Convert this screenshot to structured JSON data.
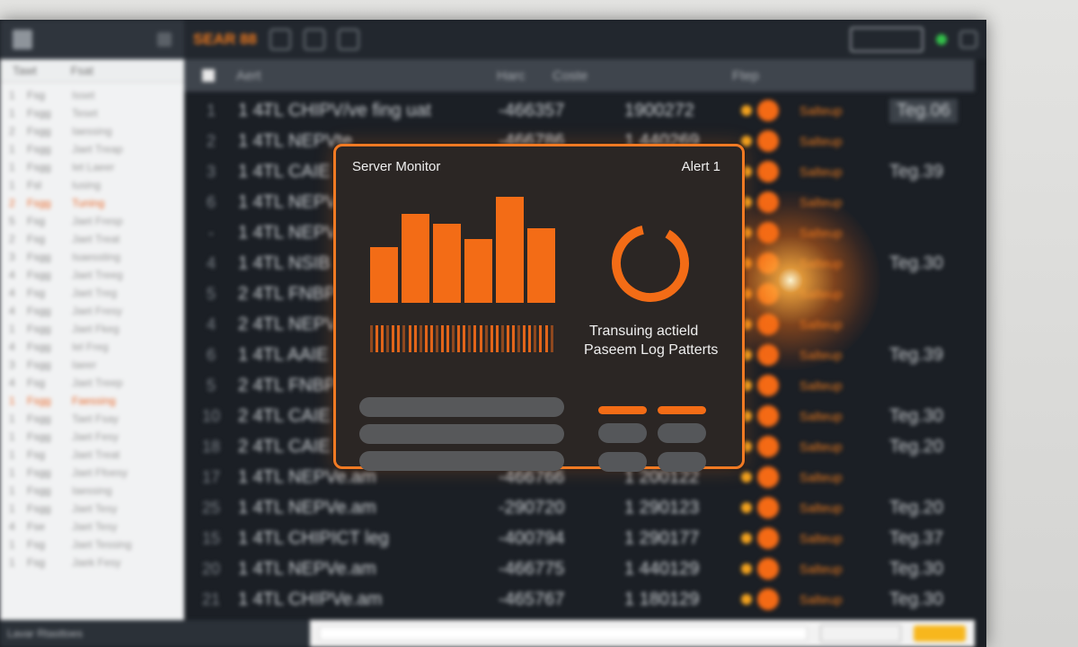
{
  "left_panel": {
    "headers": [
      "Tawt",
      "Fsat"
    ],
    "rows": [
      [
        "1",
        "Fsg",
        "Isset"
      ],
      [
        "1",
        "Fsgg",
        "Teset"
      ],
      [
        "2",
        "Fsgg",
        "Iaessing"
      ],
      [
        "1",
        "Fsgg",
        "Jaet Treap"
      ],
      [
        "1",
        "Fsgg",
        "Iet Laeer"
      ],
      [
        "1",
        "Fsl",
        "Iusing"
      ],
      [
        "2",
        "Fsgg",
        "Tuning"
      ],
      [
        "5",
        "Fsg",
        "Jaet Fresp"
      ],
      [
        "2",
        "Fsg",
        "Jaet Treat"
      ],
      [
        "3",
        "Fsgg",
        "Isaessting"
      ],
      [
        "4",
        "Fsgg",
        "Jaet Treeg"
      ],
      [
        "4",
        "Fsg",
        "Jaet Treg"
      ],
      [
        "4",
        "Fsgg",
        "Jaet Fresy"
      ],
      [
        "1",
        "Fsgg",
        "Jaet Fkeg"
      ],
      [
        "4",
        "Fsgg",
        "Iel Freg"
      ],
      [
        "3",
        "Fsgg",
        "Iaeer"
      ],
      [
        "4",
        "Fsg",
        "Jaet Treep"
      ],
      [
        "1",
        "Fsgg",
        "Faessing"
      ],
      [
        "1",
        "Fsgg",
        "Taet Fsay"
      ],
      [
        "1",
        "Fsgg",
        "Jaet Fesy"
      ],
      [
        "1",
        "Fsg",
        "Jaet Treat"
      ],
      [
        "1",
        "Fsgg",
        "Jaet Ffoesy"
      ],
      [
        "1",
        "Fsgg",
        "Iaessing"
      ],
      [
        "1",
        "Fsgg",
        "Jaet Tesy"
      ],
      [
        "4",
        "Fse",
        "Jaet Tesy"
      ],
      [
        "1",
        "Fsg",
        "Jaet Tessing"
      ],
      [
        "1",
        "Fsg",
        "Jaek Fesy"
      ]
    ],
    "highlighted": [
      6,
      17
    ],
    "footer": "Lavar Rtasttoes"
  },
  "toolbar": {
    "brand": "SEAR 88"
  },
  "table": {
    "headers": [
      "Aert",
      "Harc",
      "Coste",
      "Ftep"
    ],
    "rows": [
      {
        "num": "1",
        "name": "1 4̶TL CHIPV/ve fing uat",
        "v1": "-466357",
        "v2": "1900272",
        "status": "Salteup",
        "tag": "Teg.06"
      },
      {
        "num": "2",
        "name": "1 4TL NEPVte",
        "v1": "-466786",
        "v2": "1 440269",
        "status": "Salteup",
        "tag": ""
      },
      {
        "num": "3",
        "name": "1 4TL CAIE",
        "v1": "",
        "v2": "",
        "status": "Salteup",
        "tag": "Teg.39"
      },
      {
        "num": "6",
        "name": "1 4TL NEPV",
        "v1": "",
        "v2": "",
        "status": "Salteup",
        "tag": ""
      },
      {
        "num": "-",
        "name": "1 4TL NEPV",
        "v1": "",
        "v2": "",
        "status": "Salteup",
        "tag": ""
      },
      {
        "num": "4",
        "name": "1 4TL NSIB",
        "v1": "",
        "v2": "",
        "status": "Salteup",
        "tag": "Teg.30"
      },
      {
        "num": "5",
        "name": "2 4TL FNBP",
        "v1": "",
        "v2": "",
        "status": "Salteup",
        "tag": ""
      },
      {
        "num": "4",
        "name": "2 4TL NEPV",
        "v1": "",
        "v2": "",
        "status": "Salteup",
        "tag": ""
      },
      {
        "num": "6",
        "name": "1 4TL AAIE",
        "v1": "",
        "v2": "",
        "status": "Salteup",
        "tag": "Teg.39"
      },
      {
        "num": "5",
        "name": "2 4TL FNBP",
        "v1": "",
        "v2": "",
        "status": "Salteup",
        "tag": ""
      },
      {
        "num": "10",
        "name": "2 4TL CAIE",
        "v1": "",
        "v2": "",
        "status": "Salteup",
        "tag": "Teg.30"
      },
      {
        "num": "18",
        "name": "2 4TL CAIE",
        "v1": "",
        "v2": "",
        "status": "Salteup",
        "tag": "Teg.20"
      },
      {
        "num": "17",
        "name": "1 4TL NEPVe.am",
        "v1": "-466766",
        "v2": "1 200122",
        "status": "Salteup",
        "tag": ""
      },
      {
        "num": "25",
        "name": "1 4TL NEPVe.am",
        "v1": "-290720",
        "v2": "1 290123",
        "status": "Salteup",
        "tag": "Teg.20"
      },
      {
        "num": "15",
        "name": "1 4TL CHIPICT leg",
        "v1": "-400794",
        "v2": "1 290177",
        "status": "Salteup",
        "tag": "Teg.37"
      },
      {
        "num": "20",
        "name": "1 4TL NEPVe.am",
        "v1": "-466775",
        "v2": "1 440129",
        "status": "Salteup",
        "tag": "Teg.30"
      },
      {
        "num": "21",
        "name": "1 4TL CHIPVe.am",
        "v1": "-465767",
        "v2": "1 180129",
        "status": "Salteup",
        "tag": "Teg.30"
      }
    ]
  },
  "card": {
    "title": "Server Monitor",
    "alert": "Alert 1",
    "line1": "Transuing actield",
    "line2": "Paseem Log Patterts",
    "bars": [
      0.5,
      0.8,
      0.71,
      0.57,
      0.95,
      0.67
    ],
    "donut_fraction": 0.88,
    "accent": "#f36c16"
  },
  "colors": {
    "accent": "#f36c16",
    "card_border": "#f27a23",
    "status_ok": "#33c04a",
    "amber": "#f3a21d"
  }
}
